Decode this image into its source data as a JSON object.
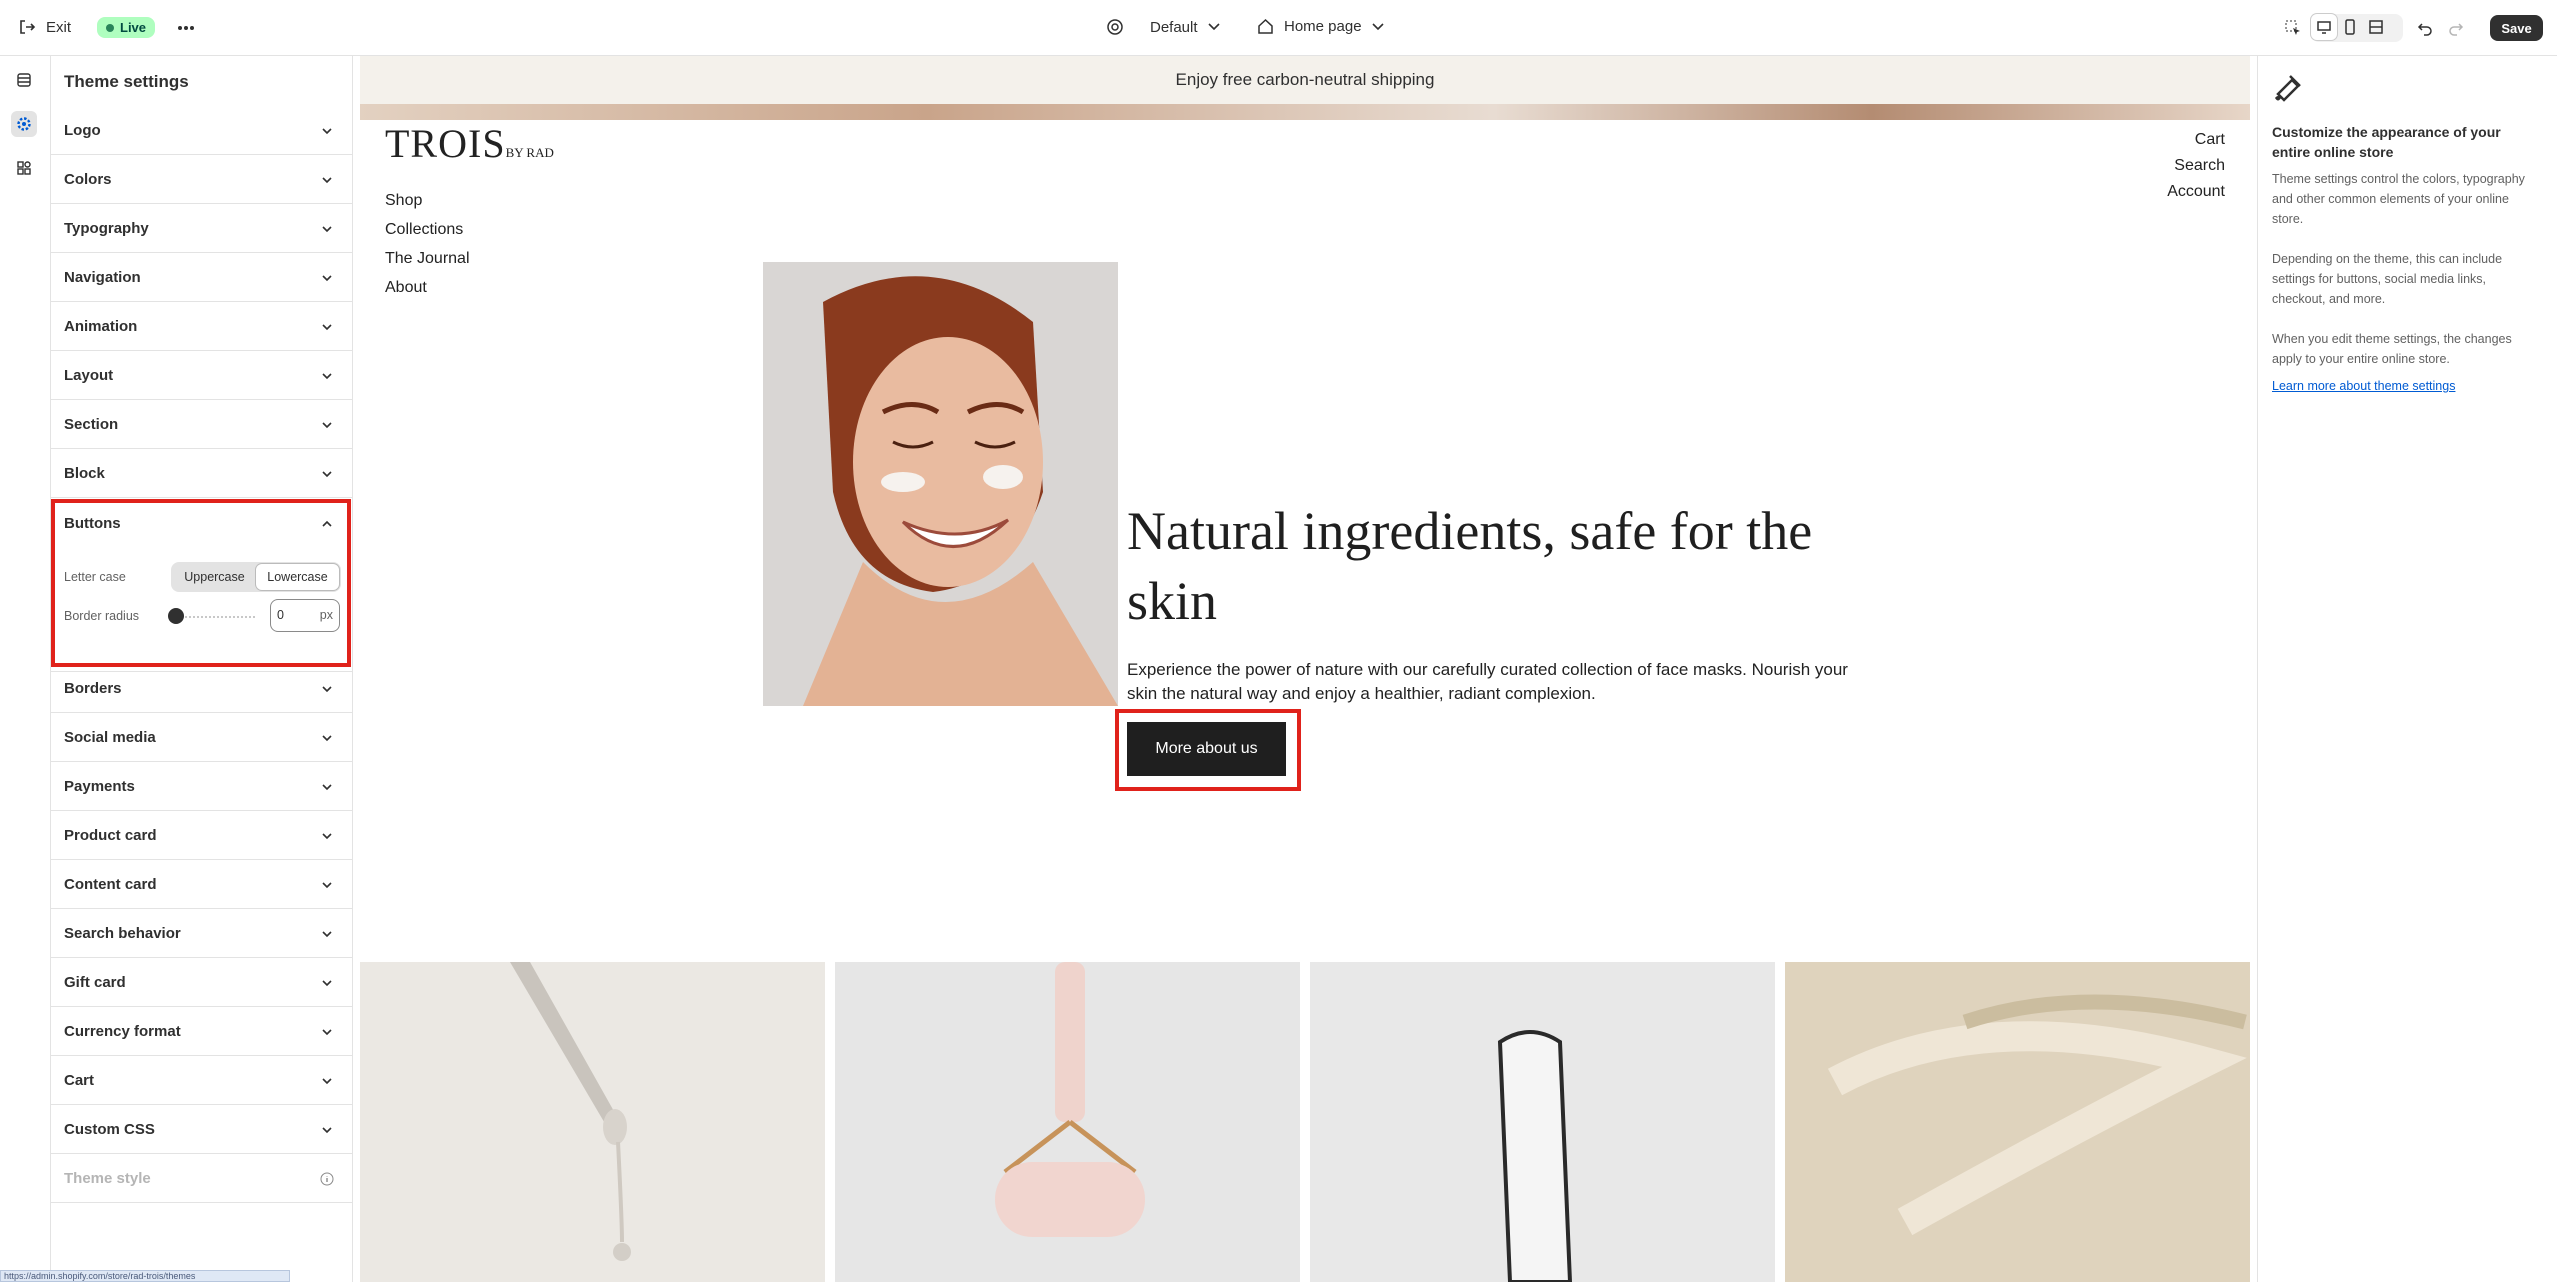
{
  "topbar": {
    "exit_label": "Exit",
    "live_badge": "Live",
    "theme_select": "Default",
    "page_select": "Home page",
    "save_label": "Save"
  },
  "left_panel": {
    "title": "Theme settings",
    "sections_before": [
      "Logo",
      "Colors",
      "Typography",
      "Navigation",
      "Animation",
      "Layout",
      "Section",
      "Block"
    ],
    "buttons_section": {
      "title": "Buttons",
      "letter_case_label": "Letter case",
      "letter_case_options": [
        "Uppercase",
        "Lowercase"
      ],
      "letter_case_selected": "Lowercase",
      "border_radius_label": "Border radius",
      "border_radius_value": "0",
      "border_radius_unit": "px"
    },
    "sections_after": [
      "Borders",
      "Social media",
      "Payments",
      "Product card",
      "Content card",
      "Search behavior",
      "Gift card",
      "Currency format",
      "Cart",
      "Custom CSS"
    ],
    "theme_style_label": "Theme style"
  },
  "preview": {
    "announcement": "Enjoy free carbon-neutral shipping",
    "logo_main": "TROIS",
    "logo_sub": "BY RAD",
    "nav": [
      "Shop",
      "Collections",
      "The Journal",
      "About"
    ],
    "utility": [
      "Cart",
      "Search",
      "Account"
    ],
    "headline": "Natural ingredients, safe for the skin",
    "body": "Experience the power of nature with our carefully curated collection of face masks. Nourish your skin the natural way and enjoy a healthier, radiant complexion.",
    "cta": "More about us"
  },
  "right_panel": {
    "title": "Customize the appearance of your entire online store",
    "para1": "Theme settings control the colors, typography and other common elements of your online store.",
    "para2": "Depending on the theme, this can include settings for buttons, social media links, checkout, and more.",
    "para3": "When you edit theme settings, the changes apply to your entire online store.",
    "link": "Learn more about theme settings"
  },
  "status_url": "https://admin.shopify.com/store/rad-trois/themes"
}
